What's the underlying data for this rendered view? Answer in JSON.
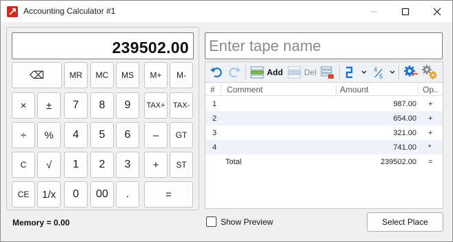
{
  "window": {
    "title": "Accounting Calculator #1"
  },
  "display": {
    "value": "239502.00"
  },
  "memory": {
    "label": "Memory = 0.00"
  },
  "keys": {
    "backspace": "⌫",
    "mr": "MR",
    "mc": "MC",
    "ms": "MS",
    "mplus": "M+",
    "mminus": "M-",
    "multiply": "×",
    "plusminus": "±",
    "seven": "7",
    "eight": "8",
    "nine": "9",
    "taxplus": "TAX+",
    "taxminus": "TAX-",
    "divide": "÷",
    "percent": "%",
    "four": "4",
    "five": "5",
    "six": "6",
    "minus": "–",
    "gt": "GT",
    "clear": "C",
    "sqrt": "√",
    "one": "1",
    "two": "2",
    "three": "3",
    "plus": "+",
    "st": "ST",
    "ce": "CE",
    "reciprocal": "1/x",
    "zero": "0",
    "doublezero": "00",
    "decimal": ".",
    "equals": "="
  },
  "tape": {
    "name_placeholder": "Enter tape name",
    "toolbar": {
      "add_label": "Add",
      "del_label": "Del"
    },
    "columns": {
      "num": "#",
      "comment": "Comment",
      "amount": "Amount",
      "op": "Op.."
    },
    "rows": [
      {
        "num": "1",
        "comment": "",
        "amount": "987.00",
        "op": "+"
      },
      {
        "num": "2",
        "comment": "",
        "amount": "654.00",
        "op": "+"
      },
      {
        "num": "3",
        "comment": "",
        "amount": "321.00",
        "op": "+"
      },
      {
        "num": "4",
        "comment": "",
        "amount": "741.00",
        "op": "*"
      }
    ],
    "total": {
      "label": "Total",
      "amount": "239502.00",
      "op": "="
    }
  },
  "footer": {
    "show_preview_label": "Show Preview",
    "select_place_label": "Select Place"
  },
  "colors": {
    "app_icon": "#d5261d",
    "undo_blue": "#1e72c8",
    "row_alt": "#eff3f9",
    "toolbar_bg": "#eef1f5"
  }
}
